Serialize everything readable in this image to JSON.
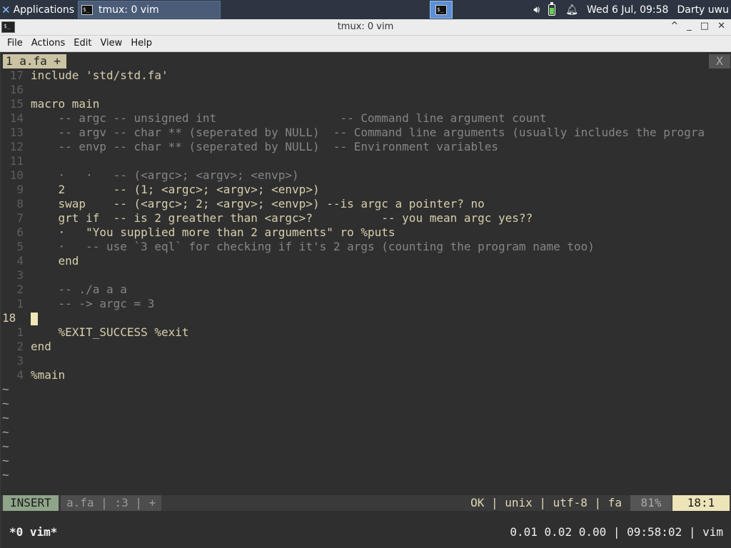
{
  "panel": {
    "apps_label": "Applications",
    "task_label": "tmux: 0 vim",
    "clock": "Wed  6 Jul, 09:58",
    "user": "Darty uwu",
    "icons": [
      "xfce-logo-icon",
      "terminal-icon",
      "volume-icon",
      "battery-icon",
      "notification-bell-icon"
    ]
  },
  "window": {
    "title": "tmux: 0 vim",
    "controls": [
      "^",
      "_",
      "□",
      "✕"
    ]
  },
  "menu": [
    "File",
    "Actions",
    "Edit",
    "View",
    "Help"
  ],
  "vim": {
    "tab_label": "1 a.fa +",
    "tab_close": "X",
    "lines": [
      {
        "n": "17",
        "cls": "",
        "text": "include 'std/std.fa'"
      },
      {
        "n": "16",
        "cls": "",
        "text": ""
      },
      {
        "n": "15",
        "cls": "",
        "text": "macro main"
      },
      {
        "n": "14",
        "cls": "cm",
        "text": "    -- argc -- unsigned int                  -- Command line argument count"
      },
      {
        "n": "13",
        "cls": "cm",
        "text": "    -- argv -- char ** (seperated by NULL)  -- Command line arguments (usually includes the progra"
      },
      {
        "n": "12",
        "cls": "cm",
        "text": "    -- envp -- char ** (seperated by NULL)  -- Environment variables"
      },
      {
        "n": "11",
        "cls": "",
        "text": ""
      },
      {
        "n": "10",
        "cls": "cm",
        "text": "    ·   ·   -- (<argc>; <argv>; <envp>)"
      },
      {
        "n": "9",
        "cls": "",
        "text": "    2       -- (1; <argc>; <argv>; <envp>)"
      },
      {
        "n": "8",
        "cls": "",
        "text": "    swap    -- (<argc>; 2; <argv>; <envp>) --is argc a pointer? no"
      },
      {
        "n": "7",
        "cls": "",
        "text": "    grt if  -- is 2 greather than <argc>?          -- you mean argc yes??"
      },
      {
        "n": "6",
        "cls": "",
        "text": "    ·   \"You supplied more than 2 arguments\" ro %puts"
      },
      {
        "n": "5",
        "cls": "cm",
        "text": "    ·   -- use `3 eql` for checking if it's 2 args (counting the program name too)"
      },
      {
        "n": "4",
        "cls": "",
        "text": "    end"
      },
      {
        "n": "3",
        "cls": "",
        "text": ""
      },
      {
        "n": "2",
        "cls": "cm",
        "text": "    -- ./a a a"
      },
      {
        "n": "1",
        "cls": "cm",
        "text": "    -- -> argc = 3"
      },
      {
        "n": "18",
        "cls": "cur",
        "text": ""
      },
      {
        "n": "1",
        "cls": "",
        "text": "    %EXIT_SUCCESS %exit"
      },
      {
        "n": "2",
        "cls": "",
        "text": "end"
      },
      {
        "n": "3",
        "cls": "",
        "text": ""
      },
      {
        "n": "4",
        "cls": "",
        "text": "%main"
      }
    ],
    "tilde": "~",
    "status": {
      "mode": "INSERT",
      "file": "a.fa | :3 | +",
      "right": "OK | unix | utf-8 | fa",
      "percent": "81%",
      "position": "18:1"
    }
  },
  "tmux": {
    "left": "*0 vim*",
    "right": "0.01 0.02 0.00 | 09:58:02 | vim"
  }
}
